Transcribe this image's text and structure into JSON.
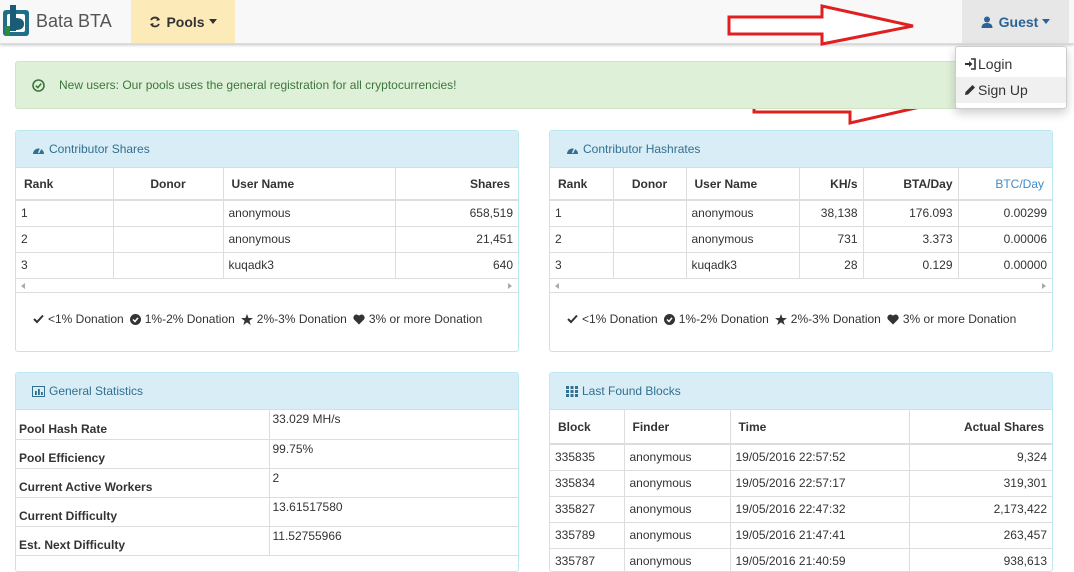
{
  "navbar": {
    "brand": "Bata BTA",
    "pools_label": "Pools",
    "guest_label": "Guest"
  },
  "dropdown": {
    "items": [
      {
        "label": "Login"
      },
      {
        "label": "Sign Up"
      }
    ]
  },
  "alert": {
    "text": "New users: Our pools uses the general registration for all cryptocurrencies!"
  },
  "contributor_shares": {
    "title": "Contributor Shares",
    "headers": [
      "Rank",
      "Donor",
      "User Name",
      "Shares"
    ],
    "rows": [
      [
        "1",
        "",
        "anonymous",
        "658,519"
      ],
      [
        "2",
        "",
        "anonymous",
        "21,451"
      ],
      [
        "3",
        "",
        "kuqadk3",
        "640"
      ]
    ]
  },
  "contributor_hashrates": {
    "title": "Contributor Hashrates",
    "headers": [
      "Rank",
      "Donor",
      "User Name",
      "KH/s",
      "BTA/Day",
      "BTC/Day"
    ],
    "rows": [
      [
        "1",
        "",
        "anonymous",
        "38,138",
        "176.093",
        "0.00299"
      ],
      [
        "2",
        "",
        "anonymous",
        "731",
        "3.373",
        "0.00006"
      ],
      [
        "3",
        "",
        "kuqadk3",
        "28",
        "0.129",
        "0.00000"
      ]
    ]
  },
  "legend": {
    "items": [
      "<1% Donation",
      "1%-2% Donation",
      "2%-3% Donation",
      "3% or more Donation"
    ]
  },
  "general_statistics": {
    "title": "General Statistics",
    "rows": [
      [
        "Pool Hash Rate",
        "33.029 MH/s"
      ],
      [
        "Pool Efficiency",
        "99.75%"
      ],
      [
        "Current Active Workers",
        "2"
      ],
      [
        "Current Difficulty",
        "13.61517580"
      ],
      [
        "Est. Next Difficulty",
        "11.52755966"
      ]
    ]
  },
  "last_found_blocks": {
    "title": "Last Found Blocks",
    "headers": [
      "Block",
      "Finder",
      "Time",
      "Actual Shares"
    ],
    "rows": [
      [
        "335835",
        "anonymous",
        "19/05/2016 22:57:52",
        "9,324"
      ],
      [
        "335834",
        "anonymous",
        "19/05/2016 22:57:17",
        "319,301"
      ],
      [
        "335827",
        "anonymous",
        "19/05/2016 22:47:32",
        "2,173,422"
      ],
      [
        "335789",
        "anonymous",
        "19/05/2016 21:47:41",
        "263,457"
      ],
      [
        "335787",
        "anonymous",
        "19/05/2016 21:40:59",
        "938,613"
      ]
    ]
  },
  "colors": {
    "accent": "#31708f",
    "alert_bg": "#dff0d8",
    "panel_heading_bg": "#d9edf7",
    "pools_bg": "#fceab8",
    "arrow": "#e02020"
  }
}
